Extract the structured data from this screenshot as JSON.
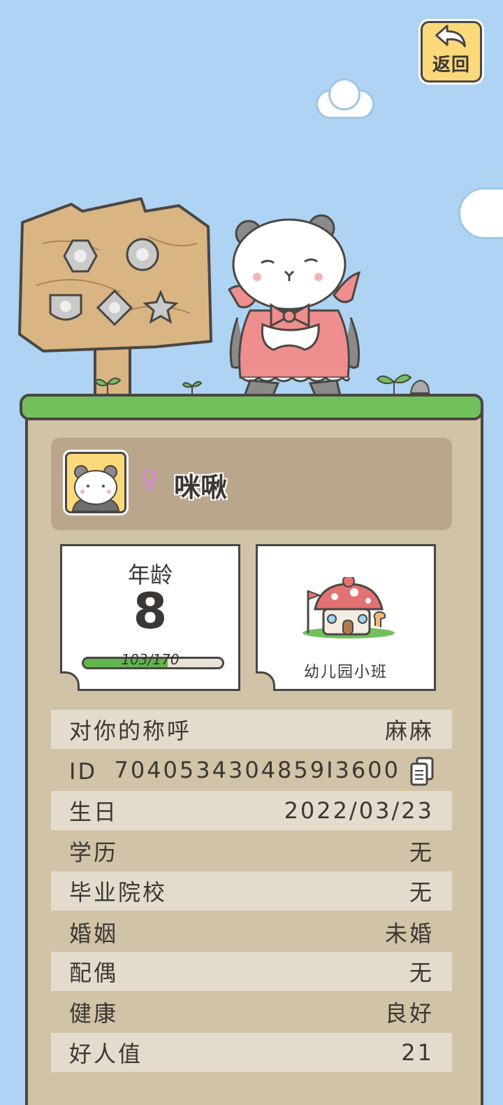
{
  "header": {
    "back_label": "返回"
  },
  "profile": {
    "gender_symbol": "♀",
    "name": "咪啾"
  },
  "age_card": {
    "label": "年龄",
    "value": "8",
    "xp_text": "103/170",
    "xp_progress": 0.606
  },
  "school_card": {
    "label": "幼儿园小班"
  },
  "info_rows": [
    {
      "label": "对你的称呼",
      "value": "麻麻"
    },
    {
      "label": "ID",
      "value": "7040534304859I3600"
    },
    {
      "label": "生日",
      "value": "2022/03/23"
    },
    {
      "label": "学历",
      "value": "无"
    },
    {
      "label": "毕业院校",
      "value": "无"
    },
    {
      "label": "婚姻",
      "value": "未婚"
    },
    {
      "label": "配偶",
      "value": "无"
    },
    {
      "label": "健康",
      "value": "良好"
    },
    {
      "label": "好人值",
      "value": "21"
    }
  ],
  "colors": {
    "sky": "#aed3f3",
    "board": "#d1c3a7",
    "grass": "#72c05c",
    "button": "#fbd97a",
    "xp_fill": "#62b44f",
    "gender": "#d689d6"
  }
}
